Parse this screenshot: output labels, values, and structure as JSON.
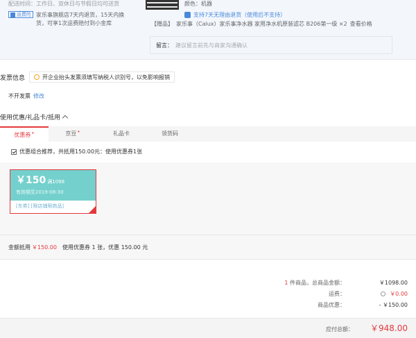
{
  "delivery": {
    "time_label": "配送时间：",
    "time_value": "工作日、双休日与节假日均可送货"
  },
  "freight": {
    "badge": "运费险",
    "desc": "家乐事旗舰店7天内退货，15天内换货，可享1次运费赔付到小金库"
  },
  "product": {
    "color_text": "颜色：机器",
    "return_text": "支持7天无理由退货（使用后不支持）",
    "gift_tag": "【赠品】",
    "gift_text": "家乐事（Calux）家乐事净水器 家用净水机原装滤芯 B206第一级 ×2",
    "gift_link": "查看价格",
    "note_label": "留言：",
    "note_placeholder": "建议留言前先与商家沟通确认"
  },
  "invoice": {
    "title": "发票信息",
    "tip": "开企业抬头发票须填写纳税人识别号，以免影响报销",
    "status": "不开发票",
    "edit": "修改"
  },
  "coupons": {
    "header": "使用优惠/礼品卡/抵用",
    "tabs": [
      {
        "label": "优惠券",
        "dot": "•"
      },
      {
        "label": "京豆",
        "dot": "•"
      },
      {
        "label": "礼品卡",
        "dot": ""
      },
      {
        "label": "领货码",
        "dot": ""
      }
    ],
    "combo_text": "优惠组合推荐，共抵用150.00元：使用优惠券1张",
    "card": {
      "amount": "￥150",
      "condition": "满1098",
      "validity": "有效期至2019-08-30",
      "scope": "[东券] [限店铺限商品]"
    },
    "summary_label": "金额抵用",
    "summary_amount": "￥150.00",
    "summary_desc": "使用优惠券 1 张，优惠 150.00 元"
  },
  "totals": {
    "items_count": "1",
    "items_label": " 件商品，总商品金额：",
    "items_value": "￥1098.00",
    "shipping_label": "运费：",
    "shipping_value": "￥0.00",
    "discount_label": "商品优惠：",
    "discount_value": "- ￥150.00",
    "payable_label": "应付总额：",
    "payable_value": "￥948.00"
  },
  "colors": {
    "accent_red": "#e4393c",
    "link_blue": "#4a88db",
    "coupon_teal": "#74d0cd"
  }
}
